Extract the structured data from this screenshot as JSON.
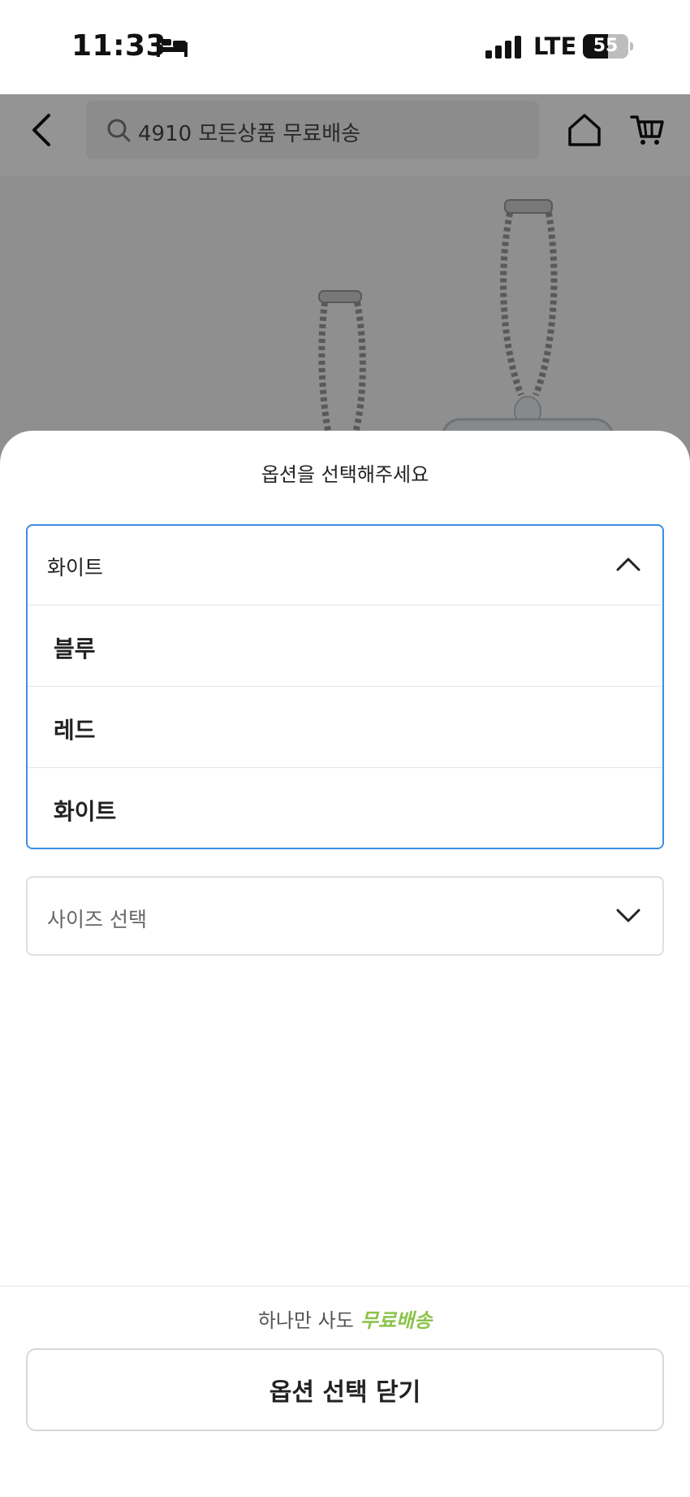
{
  "status_bar": {
    "time": "11:33",
    "network": "LTE",
    "battery_percent": 55,
    "battery_label": "55",
    "icons": [
      "bed-icon",
      "signal-icon",
      "battery-icon"
    ]
  },
  "top_nav": {
    "search_text": "4910 모든상품 무료배송",
    "icons": [
      "back-icon",
      "search-icon",
      "home-icon",
      "cart-icon"
    ]
  },
  "sheet": {
    "title": "옵션을 선택해주세요",
    "color_select": {
      "selected": "화이트",
      "expanded": true,
      "options": [
        "블루",
        "레드",
        "화이트"
      ]
    },
    "size_select": {
      "placeholder": "사이즈 선택",
      "expanded": false
    },
    "shipping_prefix": "하나만 사도",
    "shipping_highlight": "무료배송",
    "close_button_label": "옵션 선택 닫기"
  },
  "colors": {
    "accent_border": "#3d8ee0",
    "free_shipping": "#8bc34a",
    "overlay": "rgba(0,0,0,0.42)"
  }
}
